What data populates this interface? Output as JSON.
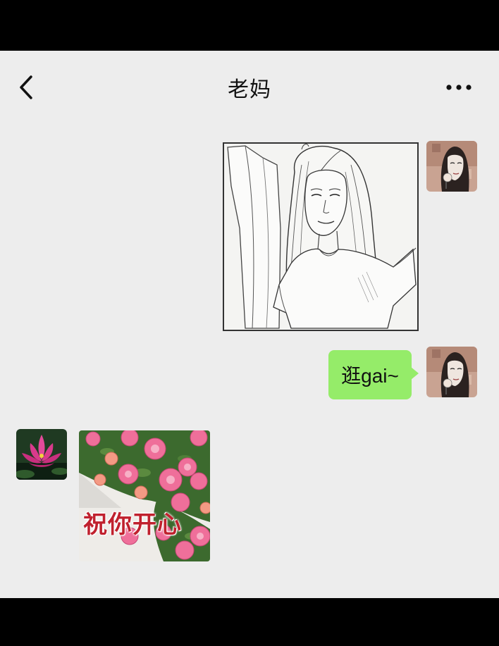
{
  "header": {
    "title": "老妈",
    "back_icon": "chevron-left-icon",
    "more_icon": "more-dots-icon"
  },
  "messages": [
    {
      "sender": "me",
      "type": "image",
      "image": "sketch-portrait-girl"
    },
    {
      "sender": "me",
      "type": "text",
      "text": "逛gai~"
    },
    {
      "sender": "mom",
      "type": "image",
      "image": "pink-roses-sticker",
      "caption": "祝你开心"
    }
  ],
  "colors": {
    "background": "#ededed",
    "bubble_me": "#95ec69",
    "caption_red": "#c0212e"
  }
}
